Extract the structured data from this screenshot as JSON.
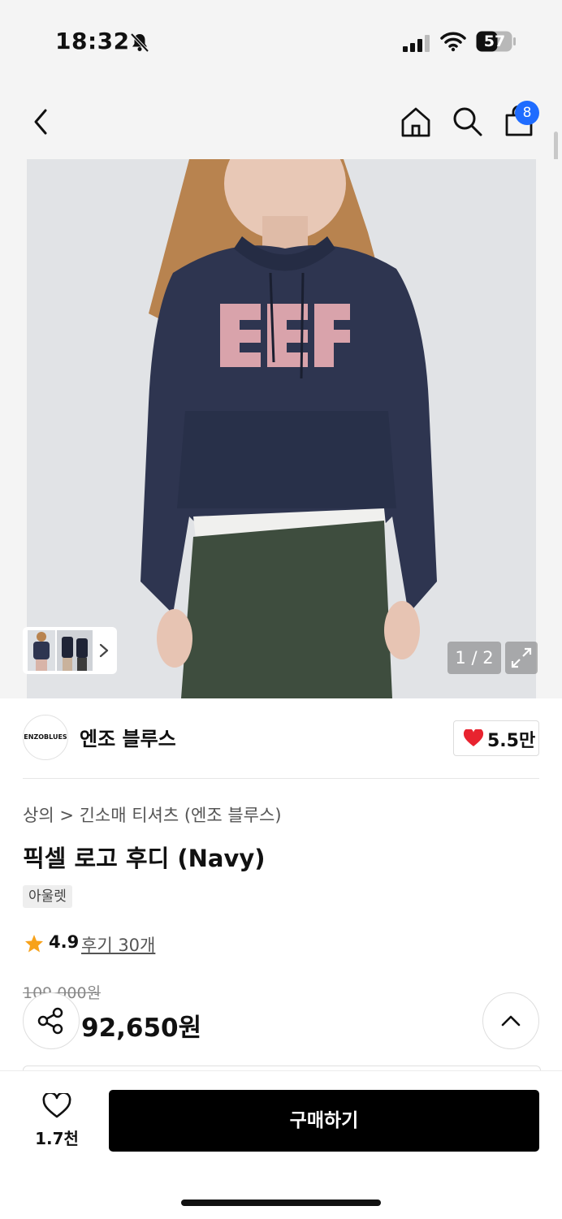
{
  "status": {
    "time": "18:32",
    "battery": "57"
  },
  "header": {
    "cart_count": "8"
  },
  "gallery": {
    "counter": "1 / 2"
  },
  "brand": {
    "logo_text": "ENZOBLUES",
    "name": "엔조 블루스",
    "likes": "5.5만"
  },
  "product": {
    "breadcrumb": "상의 > 긴소매 티셔츠 (엔조 블루스)",
    "title": "픽셀 로고 후디 (Navy)",
    "tag": "아울렛",
    "rating": "4.9",
    "reviews": "후기 30개",
    "original_price": "109,000원",
    "sale_price": "92,650원"
  },
  "bottom_bar": {
    "wish_count": "1.7천",
    "buy_label": "구매하기"
  },
  "colors": {
    "accent_blue": "#1f6cff",
    "heart_red": "#e8232f",
    "star_orange": "#f7a21b",
    "buy_bg": "#000000"
  }
}
